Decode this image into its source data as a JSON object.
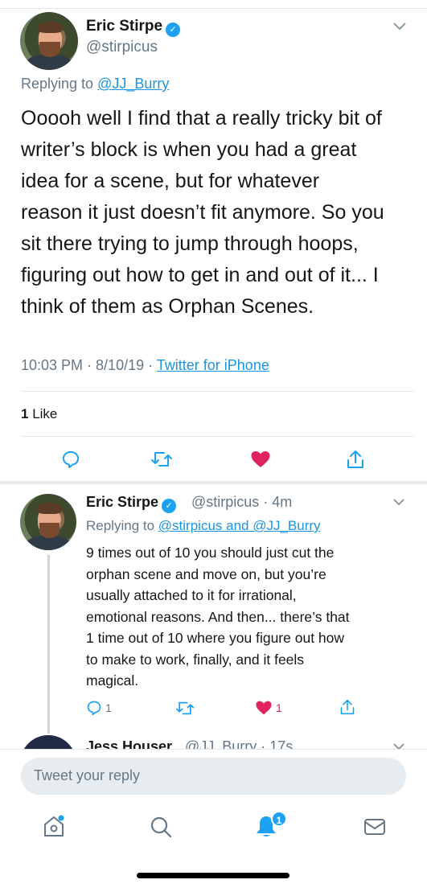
{
  "main_tweet": {
    "author_name": "Eric Stirpe",
    "handle": "@stirpicus",
    "replying_prefix": "Replying to",
    "replying_to": "@JJ_Burry",
    "text_lines": [
      "Ooooh well I find that a really tricky bit of",
      "writer’s block is when you had a great",
      "idea for a scene, but for whatever",
      "reason it just doesn’t fit anymore. So you",
      "sit there trying to jump through hoops,",
      "figuring out how to get in and out of it... I",
      "think of them as Orphan Scenes."
    ],
    "time": "10:03 PM · 8/10/19 ·",
    "source": "Twitter for iPhone",
    "like_count": "1",
    "like_label": "Like",
    "colors": {
      "liked": "#e0245e",
      "icon": "#1da1f2",
      "link": "#1b95e0"
    }
  },
  "reply_tweet": {
    "author_name": "Eric Stirpe",
    "handle_time": "@stirpicus · 4m",
    "replying_prefix": "Replying to",
    "replying_to": "@stirpicus and @JJ_Burry",
    "text_lines": [
      "9 times out of 10 you should just cut the",
      "orphan scene and move on, but you’re",
      "usually attached to it for irrational,",
      "emotional reasons. And then... there’s that",
      "1 time out of 10 where you figure out how",
      "to make to work, finally, and it feels",
      "magical."
    ],
    "reply_count": "1",
    "like_count": "1"
  },
  "peek_tweet": {
    "author_name": "Jess Houser",
    "handle_time": "@JJ_Burry · 17s"
  },
  "compose": {
    "placeholder": "Tweet your reply"
  },
  "tab_bar": {
    "items": [
      "home-icon",
      "search-icon",
      "notifications-icon",
      "messages-icon"
    ],
    "notification_badge": "1"
  }
}
